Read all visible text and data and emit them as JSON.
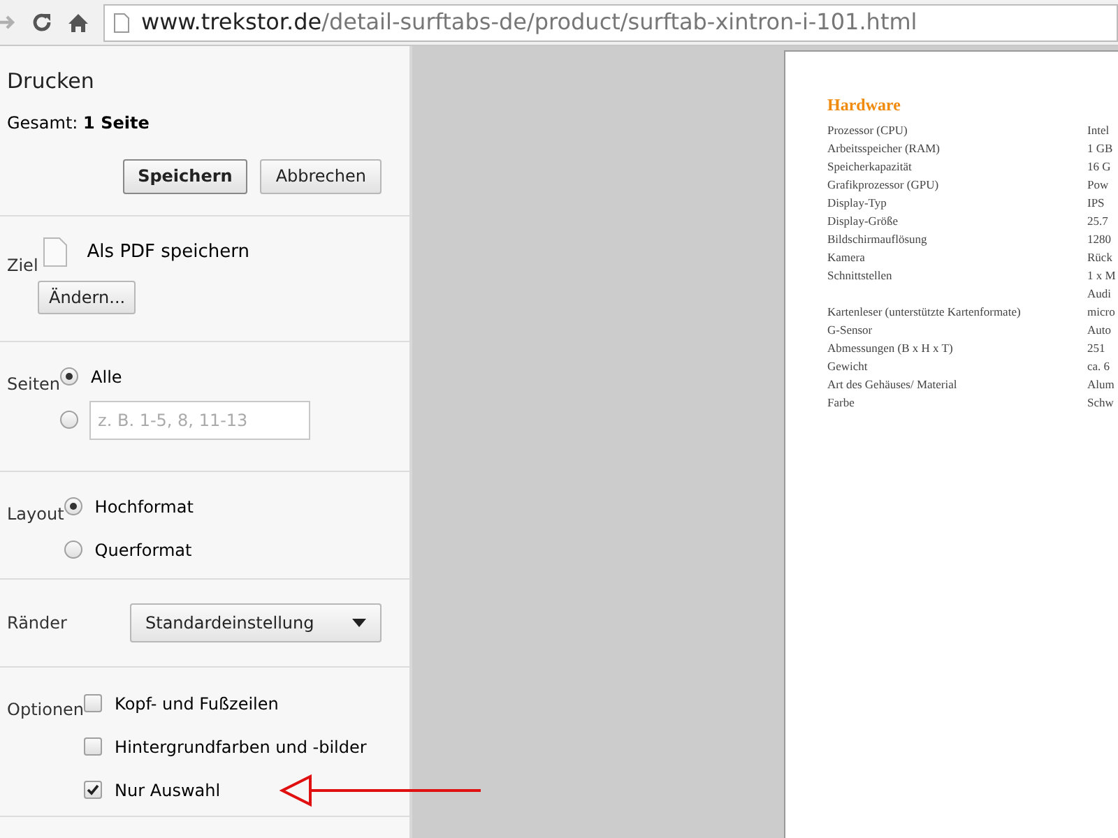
{
  "address_bar": {
    "domain": "www.trekstor.de",
    "path": "/detail-surftabs-de/product/surftab-xintron-i-101.html"
  },
  "print_panel": {
    "title": "Drucken",
    "total": "Gesamt: **1 Seite**",
    "buttons": [
      {
        "label": "Speichern",
        "kind": "primary"
      },
      {
        "label": "Abbrechen",
        "kind": "secondary"
      }
    ],
    "destination": {
      "label": "Ziel",
      "name": "Als PDF speichern",
      "button": "Ändern..."
    },
    "pages": {
      "label": "Seiten",
      "options": [
        {
          "kind": "radio",
          "label": "Alle",
          "selected": true
        },
        {
          "kind": "range",
          "placeholder": "z. B. 1-5, 8, 11-13",
          "selected": false
        }
      ]
    },
    "layout": {
      "label": "Layout",
      "options": [
        {
          "kind": "radio",
          "label": "Hochformat",
          "selected": true
        },
        {
          "kind": "radio",
          "label": "Querformat",
          "selected": false
        }
      ]
    },
    "margins": {
      "label": "Ränder",
      "value": "Standardeinstellung"
    },
    "options": {
      "label": "Optionen",
      "items": [
        {
          "label": "Kopf- und Fußzeilen",
          "checked": false
        },
        {
          "label": "Hintergrundfarben und -bilder",
          "checked": false
        },
        {
          "label": "Nur Auswahl",
          "checked": true
        }
      ]
    }
  },
  "preview": {
    "heading": "Hardware",
    "rows": [
      {
        "label": "Prozessor (CPU)",
        "value": "Intel"
      },
      {
        "label": "Arbeitsspeicher (RAM)",
        "value": "1 GB"
      },
      {
        "label": "Speicherkapazität",
        "value": "16 G"
      },
      {
        "label": "Grafikprozessor (GPU)",
        "value": "Pow"
      },
      {
        "label": "Display-Typ",
        "value": "IPS"
      },
      {
        "label": "Display-Größe",
        "value": "25.7"
      },
      {
        "label": "Bildschirmauflösung",
        "value": "1280"
      },
      {
        "label": "Kamera",
        "value": "Rück"
      },
      {
        "label": "Schnittstellen",
        "value": "1 x M"
      },
      {
        "value": "Audi"
      },
      {
        "label": "Kartenleser (unterstützte Kartenformate)",
        "value": "micro"
      },
      {
        "label": "G-Sensor",
        "value": "Auto"
      },
      {
        "label": "Abmessungen (B x H x T)",
        "value": "251"
      },
      {
        "label": "Gewicht",
        "value": "ca. 6"
      },
      {
        "label": "Art des Gehäuses/ Material",
        "value": "Alum"
      },
      {
        "label": "Farbe",
        "value": "Schw"
      }
    ]
  }
}
